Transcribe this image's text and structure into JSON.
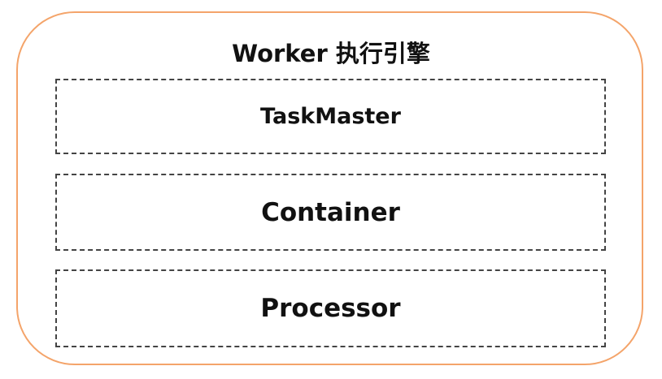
{
  "diagram": {
    "title": "Worker 执行引擎",
    "layers": [
      {
        "label": "TaskMaster"
      },
      {
        "label": "Container"
      },
      {
        "label": "Processor"
      }
    ],
    "colors": {
      "outer_border": "#F4A46A",
      "dashed_border": "#444444",
      "text": "#111111",
      "background": "#ffffff"
    }
  }
}
